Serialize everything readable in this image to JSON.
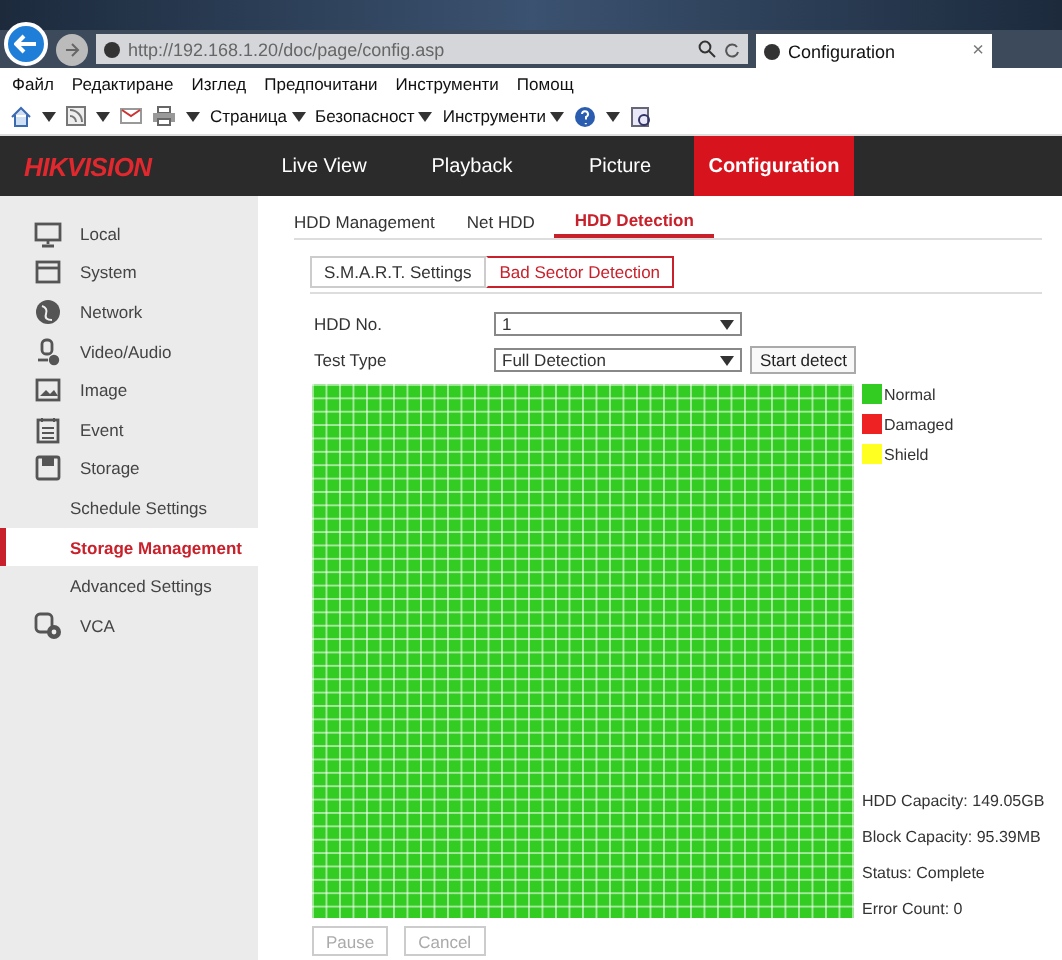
{
  "browser": {
    "address": "http://192.168.1.20/doc/page/config.asp",
    "tab_title": "Configuration",
    "tab_close": "×"
  },
  "menu_bar": [
    "Файл",
    "Редактиране",
    "Изглед",
    "Предпочитани",
    "Инструменти",
    "Помощ"
  ],
  "command_bar": [
    "Страница",
    "Безопасност",
    "Инструменти"
  ],
  "app": {
    "logo": "HIKVISION",
    "nav": [
      {
        "label": "Live View",
        "selected": false
      },
      {
        "label": "Playback",
        "selected": false
      },
      {
        "label": "Picture",
        "selected": false
      },
      {
        "label": "Configuration",
        "selected": true
      }
    ]
  },
  "sidebar": {
    "items": [
      {
        "label": "Local",
        "selected": false
      },
      {
        "label": "System",
        "selected": false
      },
      {
        "label": "Network",
        "selected": false
      },
      {
        "label": "Video/Audio",
        "selected": false
      },
      {
        "label": "Image",
        "selected": false
      },
      {
        "label": "Event",
        "selected": false
      },
      {
        "label": "Storage",
        "selected": false,
        "children": [
          {
            "label": "Schedule Settings",
            "selected": false
          },
          {
            "label": "Storage Management",
            "selected": true
          },
          {
            "label": "Advanced Settings",
            "selected": false
          }
        ]
      },
      {
        "label": "VCA",
        "selected": false
      }
    ]
  },
  "tabs": [
    {
      "label": "HDD Management",
      "selected": false
    },
    {
      "label": "Net HDD",
      "selected": false
    },
    {
      "label": "HDD Detection",
      "selected": true
    }
  ],
  "sub_tabs": [
    {
      "label": "S.M.A.R.T. Settings",
      "selected": false
    },
    {
      "label": "Bad Sector Detection",
      "selected": true
    }
  ],
  "form": {
    "hdd_no": {
      "label": "HDD No.",
      "value": "1"
    },
    "test_type": {
      "label": "Test Type",
      "value": "Full Detection"
    },
    "start_button": "Start detect"
  },
  "legend": [
    {
      "label": "Normal",
      "color": "#33cc22"
    },
    {
      "label": "Damaged",
      "color": "#ee2222"
    },
    {
      "label": "Shield",
      "color": "#ffff22"
    }
  ],
  "info": [
    "HDD Capacity: 149.05GB",
    "Block Capacity: 95.39MB",
    "Status: Complete",
    "Error Count: 0"
  ],
  "buttons": [
    {
      "label": "Pause",
      "disabled": true
    },
    {
      "label": "Cancel",
      "disabled": true
    }
  ]
}
